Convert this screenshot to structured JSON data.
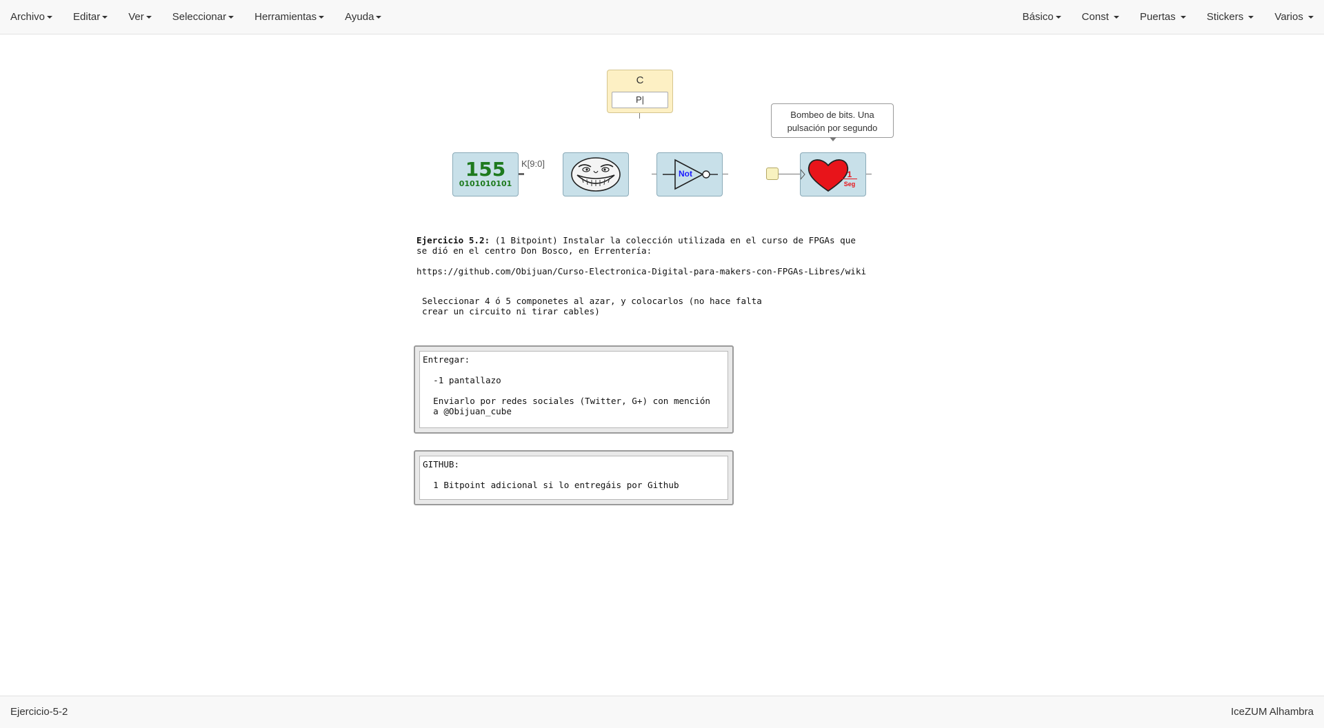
{
  "menu": {
    "left": [
      {
        "label": "Archivo"
      },
      {
        "label": "Editar"
      },
      {
        "label": "Ver"
      },
      {
        "label": "Seleccionar"
      },
      {
        "label": "Herramientas"
      },
      {
        "label": "Ayuda"
      }
    ],
    "right": [
      {
        "label": "Básico"
      },
      {
        "label": "Const"
      },
      {
        "label": "Puertas"
      },
      {
        "label": "Stickers"
      },
      {
        "label": "Varios"
      }
    ]
  },
  "canvas": {
    "const_block": {
      "label": "C",
      "value": "P|"
    },
    "counter_block": {
      "value": "155",
      "binary": "0101010101",
      "port_label": "K[9:0]"
    },
    "not_block": {
      "label": "Not"
    },
    "heart_block": {
      "value": "1",
      "unit": "Seg"
    },
    "tooltip": {
      "line1": "Bombeo de bits. Una",
      "line2": "pulsación por segundo"
    },
    "text": {
      "exercise_title": "Ejercicio 5.2:",
      "exercise_line1": " (1 Bitpoint) Instalar la colección utilizada en el curso de FPGAs que",
      "exercise_line2": "se dió en el centro Don Bosco, en Errentería:",
      "url": "https://github.com/Obijuan/Curso-Electronica-Digital-para-makers-con-FPGAs-Libres/wiki",
      "select_line1": "Seleccionar 4 ó 5 componetes al azar, y colocarlos (no hace falta",
      "select_line2": "crear un circuito ni tirar cables)"
    },
    "entregar_panel": {
      "line1": "Entregar:",
      "line2": "  -1 pantallazo",
      "line3": "  Enviarlo por redes sociales (Twitter, G+) con mención",
      "line4": "  a @Obijuan_cube"
    },
    "github_panel": {
      "line1": "GITHUB:",
      "line2": "  1 Bitpoint adicional si lo entregáis por Github"
    }
  },
  "footer": {
    "project_name": "Ejercicio-5-2",
    "board": "IceZUM Alhambra"
  },
  "colors": {
    "block_bg": "#c8e0e9",
    "const_bg": "#fdf0c4",
    "counter_text": "#1e7a1e",
    "heart": "#e8141a",
    "not_text": "#1a1aff"
  }
}
